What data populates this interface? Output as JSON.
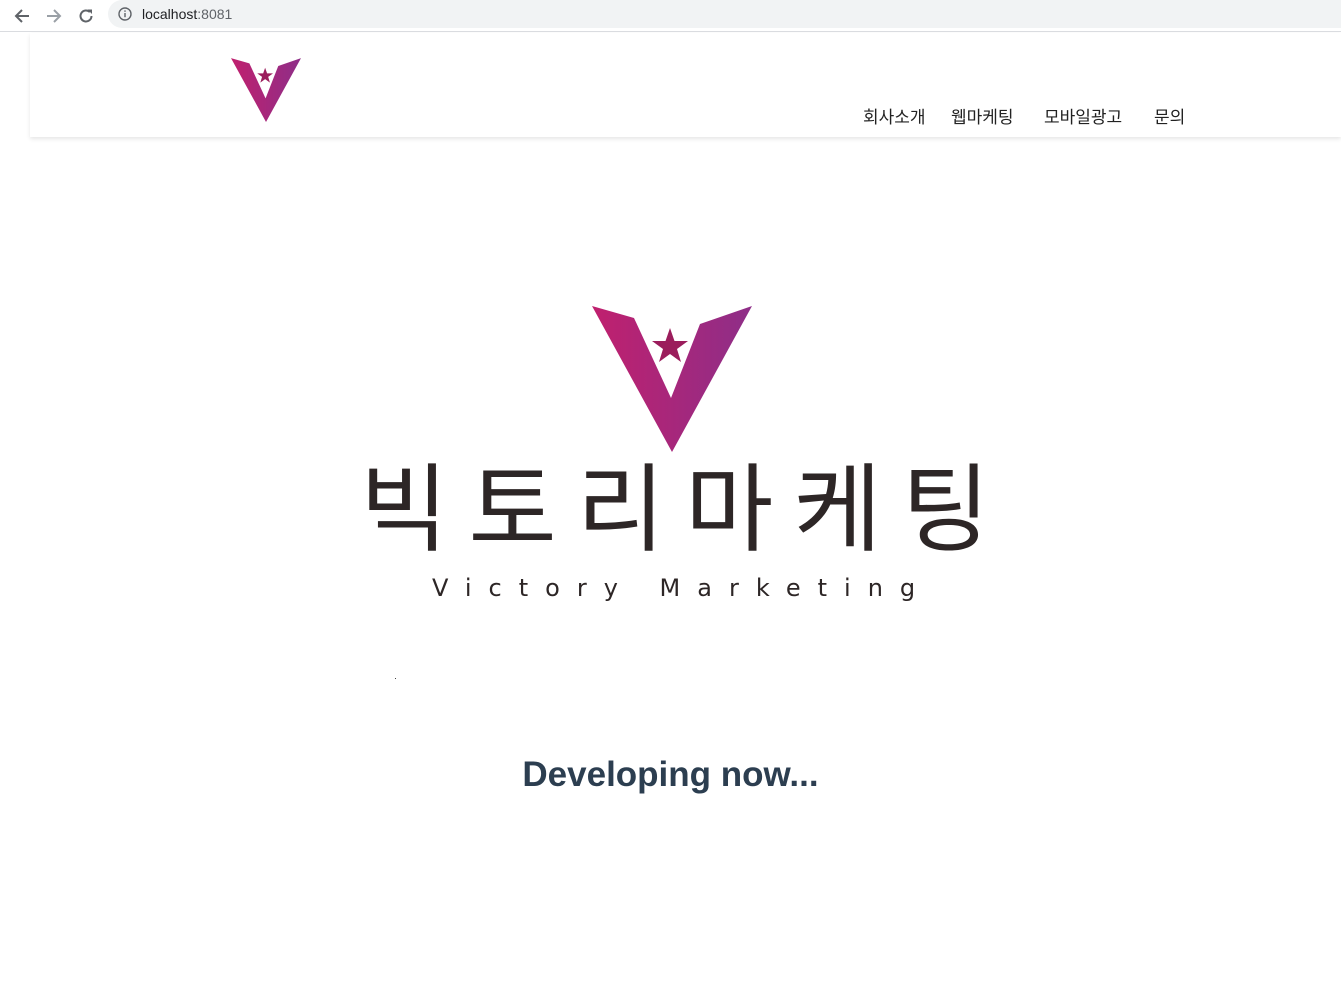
{
  "browser": {
    "url_host": "localhost",
    "url_port": ":8081"
  },
  "header": {
    "nav_items": [
      "회사소개",
      "웹마케팅",
      "모바일광고",
      "문의"
    ]
  },
  "hero": {
    "title_chars": [
      "빅",
      "토",
      "리",
      "마",
      "케",
      "팅"
    ],
    "subtitle": "Victory Marketing"
  },
  "status": {
    "text": "Developing now..."
  },
  "colors": {
    "brand_start": "#c0206e",
    "brand_end": "#8e2e88",
    "title_text": "#2d2626",
    "status_text": "#2c3e50"
  },
  "icons": {
    "back": "arrow-left-icon",
    "forward": "arrow-right-icon",
    "reload": "reload-icon",
    "info": "info-icon",
    "logo": "v-star-logo"
  }
}
